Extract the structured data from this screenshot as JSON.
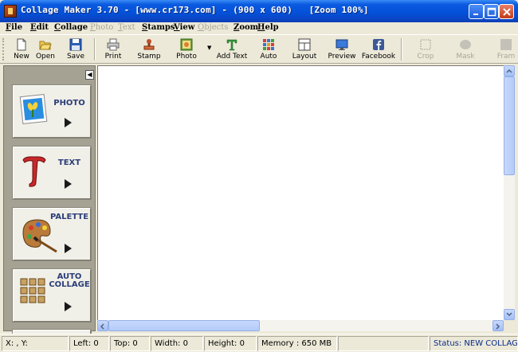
{
  "window": {
    "title": "Collage Maker 3.70 - [www.cr173.com] - (900 x 600)   [Zoom 100%]",
    "controls": [
      "minimize",
      "maximize",
      "close"
    ]
  },
  "menu": [
    {
      "label": "File",
      "enabled": true
    },
    {
      "label": "Edit",
      "enabled": true
    },
    {
      "label": "Collage",
      "enabled": true
    },
    {
      "label": "Photo",
      "enabled": false
    },
    {
      "label": "Text",
      "enabled": false
    },
    {
      "label": "Stamps",
      "enabled": true
    },
    {
      "label": "View",
      "enabled": true
    },
    {
      "label": "Objects",
      "enabled": false
    },
    {
      "label": "Zoom",
      "enabled": true
    },
    {
      "label": "Help",
      "enabled": true
    }
  ],
  "toolbar": {
    "new": "New",
    "open": "Open",
    "save": "Save",
    "print": "Print",
    "stamp": "Stamp",
    "photo": "Photo",
    "add_text": "Add Text",
    "auto": "Auto",
    "layout": "Layout",
    "preview": "Preview",
    "facebook": "Facebook",
    "crop": "Crop",
    "mask": "Mask",
    "frame": "Fram"
  },
  "left_panel": {
    "photo": "PHOTO",
    "text": "TEXT",
    "palette": "PALETTE",
    "auto_collage_1": "AUTO",
    "auto_collage_2": "COLLAGE"
  },
  "statusbar": {
    "xy": "X: , Y:",
    "left": "Left: 0",
    "top": "Top: 0",
    "width": "Width: 0",
    "height": "Height: 0",
    "memory": "Memory : 650 MB",
    "empty": "",
    "status": "Status: NEW COLLAGE"
  },
  "colors": {
    "titlebar": "#0450d8",
    "panel_label": "#2b3d78",
    "status_text": "#0a2a8c"
  }
}
